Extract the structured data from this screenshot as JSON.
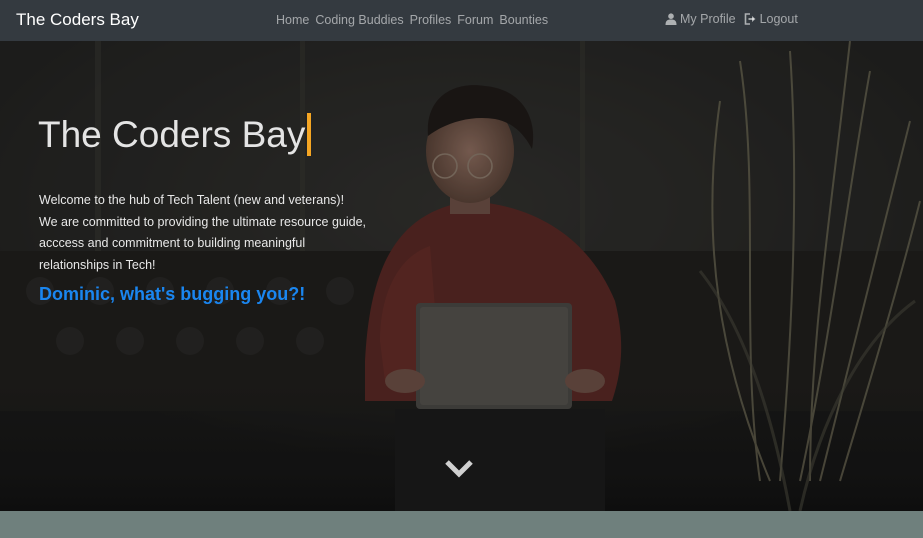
{
  "navbar": {
    "brand": "The Coders Bay",
    "links": [
      "Home",
      "Coding Buddies",
      "Profiles",
      "Forum",
      "Bounties"
    ],
    "my_profile": "My Profile",
    "logout": "Logout",
    "profile_icon": "user-icon",
    "logout_icon": "logout-icon"
  },
  "hero": {
    "title": "The Coders Bay",
    "lines": [
      "Welcome to the hub of Tech Talent (new and veterans)!",
      "We are committed to providing the ultimate resource guide,",
      "acccess and commitment to building meaningful",
      "relationships in Tech!"
    ],
    "question": "Dominic, what's bugging you?!",
    "scroll_icon": "chevron-down-icon",
    "background_image": "person-with-laptop-photo"
  },
  "colors": {
    "navbar_bg": "#343a40",
    "accent_cursor": "#f5a623",
    "question_blue": "#1a86f0",
    "footer_band": "#6f807d"
  }
}
